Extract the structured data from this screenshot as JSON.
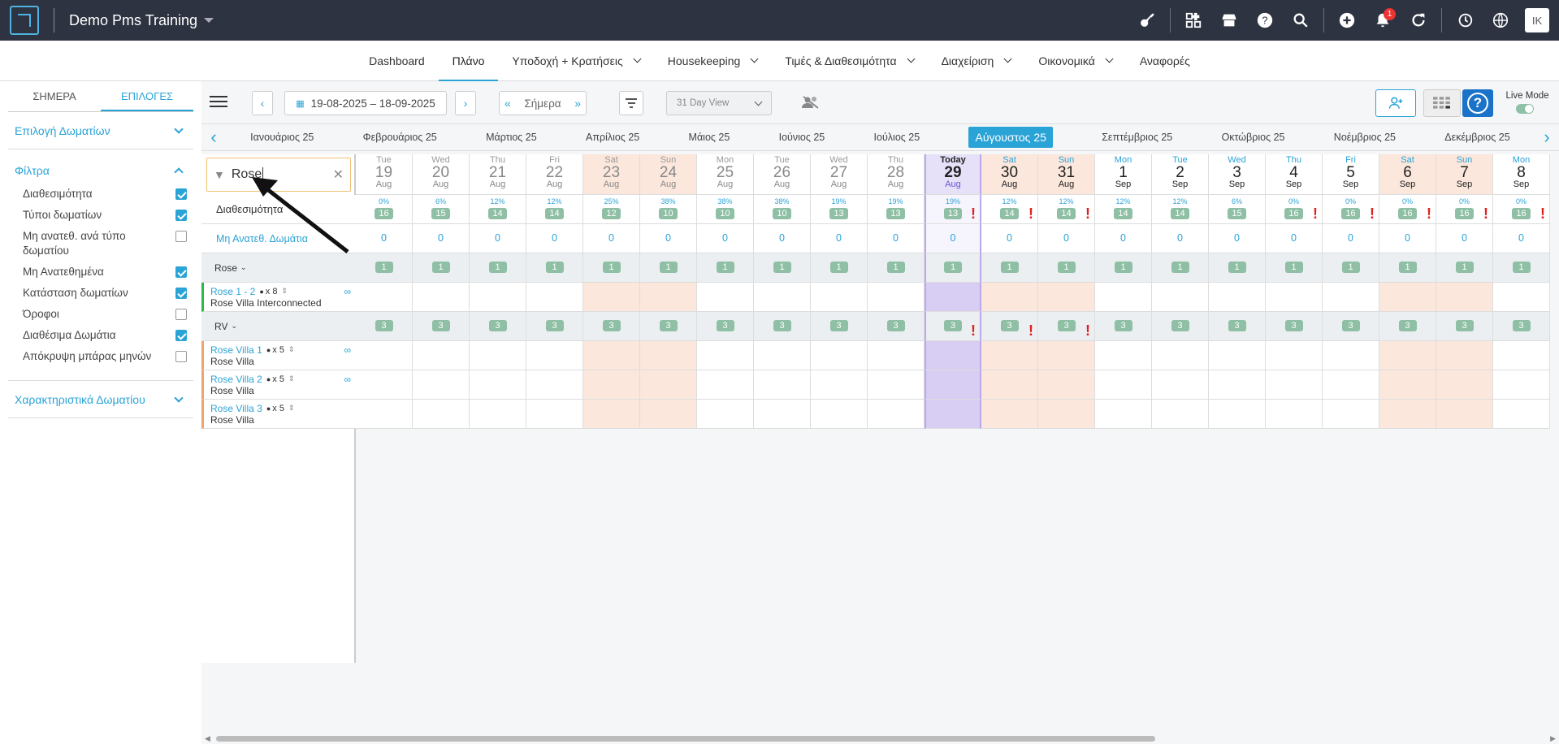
{
  "app": {
    "title": "Demo Pms Training",
    "avatar_initials": "IK",
    "notification_count": "1"
  },
  "nav": [
    {
      "label": "Dashboard",
      "dropdown": false
    },
    {
      "label": "Πλάνο",
      "dropdown": false,
      "active": true
    },
    {
      "label": "Υποδοχή + Κρατήσεις",
      "dropdown": true
    },
    {
      "label": "Housekeeping",
      "dropdown": true
    },
    {
      "label": "Τιμές & Διαθεσιμότητα",
      "dropdown": true
    },
    {
      "label": "Διαχείριση",
      "dropdown": true
    },
    {
      "label": "Οικονομικά",
      "dropdown": true
    },
    {
      "label": "Αναφορές",
      "dropdown": false
    }
  ],
  "sidebar": {
    "tabs": [
      "ΣΗΜΕΡΑ",
      "ΕΠΙΛΟΓΕΣ"
    ],
    "room_select": "Επιλογή Δωματίων",
    "filters_title": "Φίλτρα",
    "filters": [
      {
        "label": "Διαθεσιμότητα",
        "checked": true
      },
      {
        "label": "Τύποι δωματίων",
        "checked": true
      },
      {
        "label": "Μη ανατεθ. ανά τύπο δωματίου",
        "checked": false
      },
      {
        "label": "Μη Ανατεθημένα",
        "checked": true
      },
      {
        "label": "Κατάσταση δωματίων",
        "checked": true
      },
      {
        "label": "Όροφοι",
        "checked": false
      },
      {
        "label": "Διαθέσιμα Δωμάτια",
        "checked": true
      },
      {
        "label": "Απόκρυψη μπάρας μηνών",
        "checked": false
      }
    ],
    "room_features": "Χαρακτηριστικά Δωματίου"
  },
  "toolbar": {
    "date_range": "19-08-2025 – 18-09-2025",
    "today": "Σήμερα",
    "view": "31 Day View",
    "live_mode": "Live Mode"
  },
  "months": [
    "Ιανουάριος 25",
    "Φεβρουάριος 25",
    "Μάρτιος 25",
    "Απρίλιος 25",
    "Μάιος 25",
    "Ιούνιος 25",
    "Ιούλιος 25",
    "Αύγουστος 25",
    "Σεπτέμβριος 25",
    "Οκτώβριος 25",
    "Νοέμβριος 25",
    "Δεκέμβριος 25"
  ],
  "active_month_index": 7,
  "search": {
    "value": "Rose"
  },
  "labels": {
    "availability": "Διαθεσιμότητα",
    "unassigned": "Μη Ανατεθ. Δωμάτια"
  },
  "days": [
    {
      "dow": "Tue",
      "d": "19",
      "m": "Aug",
      "pct": "0%",
      "avail": "16",
      "past": true
    },
    {
      "dow": "Wed",
      "d": "20",
      "m": "Aug",
      "pct": "6%",
      "avail": "15",
      "past": true
    },
    {
      "dow": "Thu",
      "d": "21",
      "m": "Aug",
      "pct": "12%",
      "avail": "14",
      "past": true
    },
    {
      "dow": "Fri",
      "d": "22",
      "m": "Aug",
      "pct": "12%",
      "avail": "14",
      "past": true
    },
    {
      "dow": "Sat",
      "d": "23",
      "m": "Aug",
      "pct": "25%",
      "avail": "12",
      "past": true,
      "weekend": true
    },
    {
      "dow": "Sun",
      "d": "24",
      "m": "Aug",
      "pct": "38%",
      "avail": "10",
      "past": true,
      "weekend": true
    },
    {
      "dow": "Mon",
      "d": "25",
      "m": "Aug",
      "pct": "38%",
      "avail": "10",
      "past": true
    },
    {
      "dow": "Tue",
      "d": "26",
      "m": "Aug",
      "pct": "38%",
      "avail": "10",
      "past": true
    },
    {
      "dow": "Wed",
      "d": "27",
      "m": "Aug",
      "pct": "19%",
      "avail": "13",
      "past": true
    },
    {
      "dow": "Thu",
      "d": "28",
      "m": "Aug",
      "pct": "19%",
      "avail": "13",
      "past": true
    },
    {
      "dow": "Today",
      "d": "29",
      "m": "Aug",
      "pct": "19%",
      "avail": "13",
      "today": true,
      "alert": true,
      "rv_alert": true
    },
    {
      "dow": "Sat",
      "d": "30",
      "m": "Aug",
      "pct": "12%",
      "avail": "14",
      "weekend": true,
      "alert": true,
      "rv_alert": true
    },
    {
      "dow": "Sun",
      "d": "31",
      "m": "Aug",
      "pct": "12%",
      "avail": "14",
      "weekend": true,
      "alert": true,
      "rv_alert": true
    },
    {
      "dow": "Mon",
      "d": "1",
      "m": "Sep",
      "pct": "12%",
      "avail": "14"
    },
    {
      "dow": "Tue",
      "d": "2",
      "m": "Sep",
      "pct": "12%",
      "avail": "14"
    },
    {
      "dow": "Wed",
      "d": "3",
      "m": "Sep",
      "pct": "6%",
      "avail": "15"
    },
    {
      "dow": "Thu",
      "d": "4",
      "m": "Sep",
      "pct": "0%",
      "avail": "16",
      "alert": true
    },
    {
      "dow": "Fri",
      "d": "5",
      "m": "Sep",
      "pct": "0%",
      "avail": "16",
      "alert": true
    },
    {
      "dow": "Sat",
      "d": "6",
      "m": "Sep",
      "pct": "0%",
      "avail": "16",
      "weekend": true,
      "alert": true
    },
    {
      "dow": "Sun",
      "d": "7",
      "m": "Sep",
      "pct": "0%",
      "avail": "16",
      "weekend": true,
      "alert": true
    },
    {
      "dow": "Mon",
      "d": "8",
      "m": "Sep",
      "pct": "0%",
      "avail": "16",
      "alert": true
    }
  ],
  "unassigned_value": "0",
  "groups": [
    {
      "name": "Rose",
      "count": "1",
      "rooms": [
        {
          "name": "Rose 1 - 2",
          "cap": "x 8",
          "type": "Rose Villa Interconnected",
          "link": true,
          "color": "#2db84d"
        }
      ]
    },
    {
      "name": "RV",
      "count": "3",
      "rooms": [
        {
          "name": "Rose Villa 1",
          "cap": "x 5",
          "type": "Rose Villa",
          "link": true,
          "color": "#f0a36b"
        },
        {
          "name": "Rose Villa 2",
          "cap": "x 5",
          "type": "Rose Villa",
          "link": true,
          "color": "#f0a36b"
        },
        {
          "name": "Rose Villa 3",
          "cap": "x 5",
          "type": "Rose Villa",
          "link": false,
          "color": "#f0a36b"
        }
      ]
    }
  ],
  "colors": {
    "accent": "#2aa3d6",
    "today": "#d8cdf3",
    "weekend": "#fbe7dc",
    "chip": "#8fbfa5",
    "alert": "#e02020"
  }
}
